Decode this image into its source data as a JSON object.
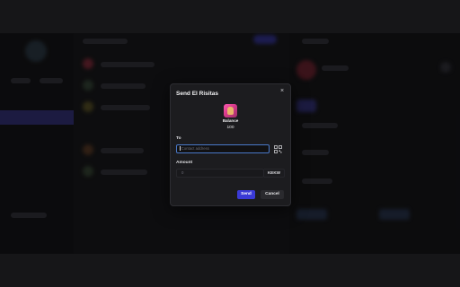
{
  "modal": {
    "title": "Send El Risitas",
    "close_symbol": "×",
    "balance_label": "Balance",
    "balance_value": "100",
    "to_label": "To",
    "to_placeholder": "Contact address",
    "amount_label": "Amount",
    "amount_placeholder": "0",
    "amount_unit": "KEKW",
    "send_label": "Send",
    "cancel_label": "Cancel"
  },
  "colors": {
    "accent": "#3a3ad6",
    "input_focus": "#4a78c8",
    "nav_selected": "#2b2a64"
  }
}
